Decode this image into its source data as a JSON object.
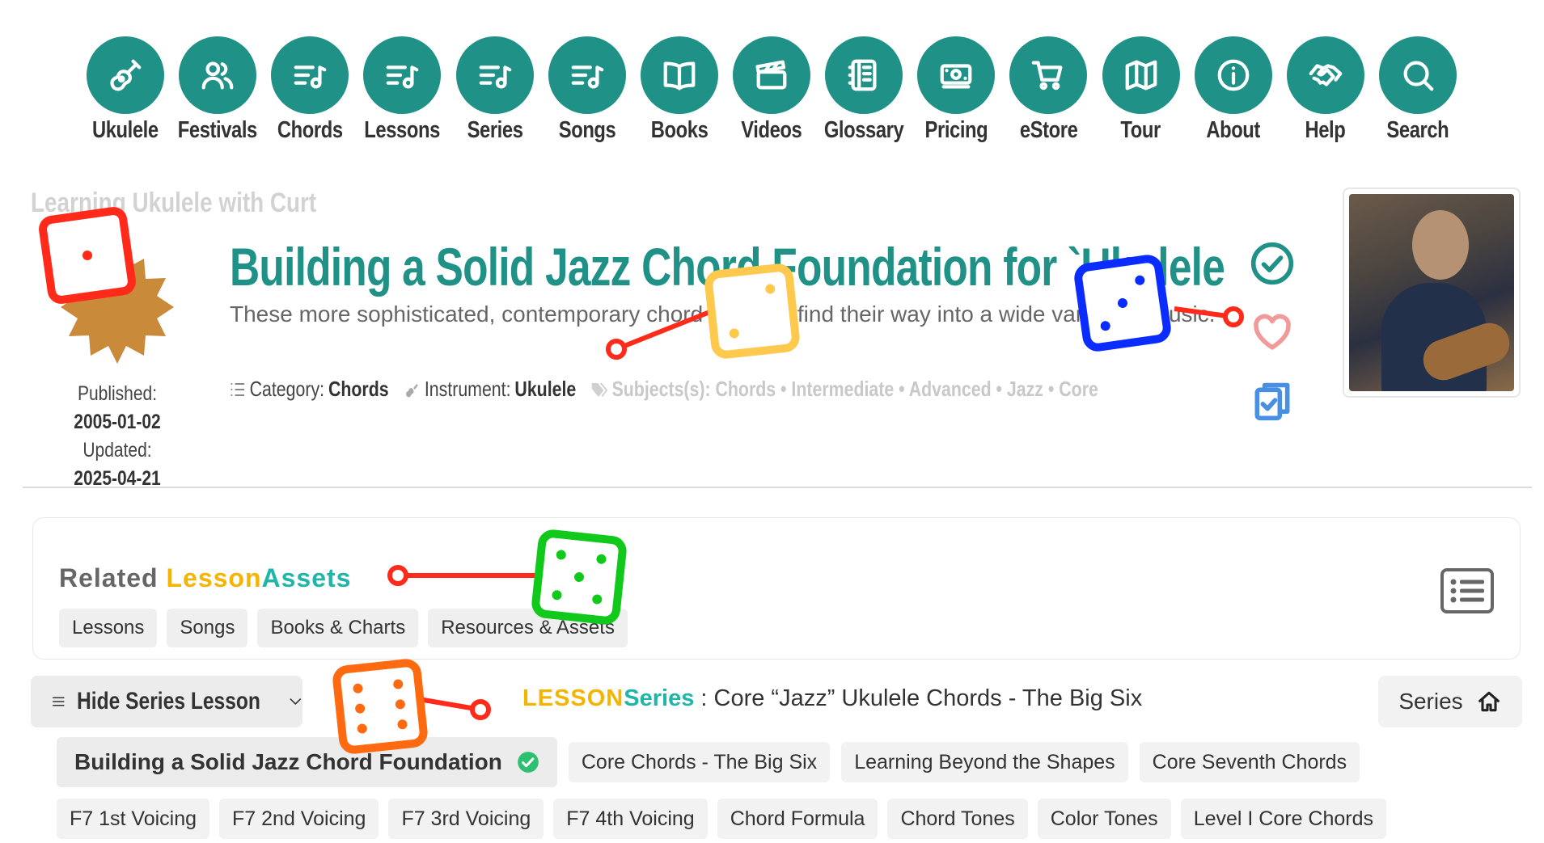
{
  "nav": [
    {
      "label": "Ukulele",
      "icon": "ukulele-icon"
    },
    {
      "label": "Festivals",
      "icon": "people-icon"
    },
    {
      "label": "Chords",
      "icon": "music-list-icon"
    },
    {
      "label": "Lessons",
      "icon": "music-list-icon"
    },
    {
      "label": "Series",
      "icon": "music-list-icon"
    },
    {
      "label": "Songs",
      "icon": "music-list-icon"
    },
    {
      "label": "Books",
      "icon": "book-icon"
    },
    {
      "label": "Videos",
      "icon": "clapperboard-icon"
    },
    {
      "label": "Glossary",
      "icon": "notebook-icon"
    },
    {
      "label": "Pricing",
      "icon": "money-icon"
    },
    {
      "label": "eStore",
      "icon": "cart-icon"
    },
    {
      "label": "Tour",
      "icon": "map-icon"
    },
    {
      "label": "About",
      "icon": "info-icon"
    },
    {
      "label": "Help",
      "icon": "handshake-icon"
    },
    {
      "label": "Search",
      "icon": "search-icon"
    }
  ],
  "header": {
    "site_tag": "Learning Ukulele with Curt",
    "published_label": "Published:",
    "published_date": "2005-01-02",
    "updated_label": "Updated:",
    "updated_date": "2025-04-21",
    "title": "Building a Solid Jazz Chord Foundation for `Ukulele",
    "description": "These more sophisticated, contemporary chord voicings find their way into a wide variety of music.",
    "category_label": "Category:",
    "category": "Chords",
    "instrument_label": "Instrument:",
    "instrument": "Ukulele",
    "subjects": "Subjects(s): Chords • Intermediate • Advanced • Jazz • Core"
  },
  "related": {
    "title_prefix": "Related ",
    "title_lesson": "Lesson",
    "title_assets": "Assets",
    "chips": [
      "Lessons",
      "Songs",
      "Books & Charts",
      "Resources & Assets"
    ]
  },
  "series": {
    "hide_label": "Hide Series Lesson",
    "prefix_lesson": "LESSON",
    "prefix_series": "Series",
    "name": " : Core “Jazz” Ukulele Chords - The Big Six",
    "series_button": "Series",
    "active_lesson": "Building a Solid Jazz Chord Foundation",
    "row1": [
      "Core Chords - The Big Six",
      "Learning Beyond the Shapes",
      "Core Seventh Chords"
    ],
    "row2": [
      "F7 1st Voicing",
      "F7 2nd Voicing",
      "F7 3rd Voicing",
      "F7 4th Voicing",
      "Chord Formula",
      "Chord Tones",
      "Color Tones",
      "Level I Core Chords"
    ]
  },
  "colors": {
    "teal": "#1f9187",
    "accent": "#f4b400",
    "light_teal": "#1fb5a9"
  }
}
